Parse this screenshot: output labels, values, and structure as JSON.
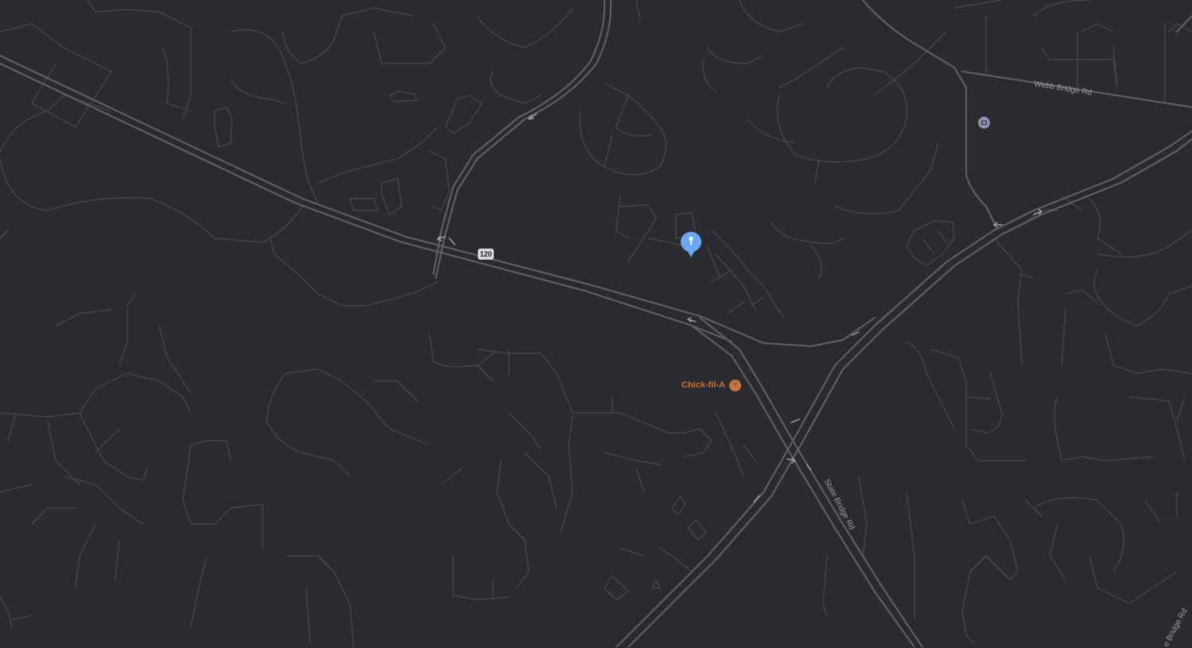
{
  "map": {
    "theme": "dark",
    "colors": {
      "background": "#2a2b2e",
      "minor_road": "#45474b",
      "major_road": "#5b5d62",
      "poi_food": "#c8733f",
      "pin": "#6ba9f2"
    },
    "road_labels": {
      "webb_bridge": "Webb Bridge Rd",
      "state_bridge": "State Bridge Rd",
      "state_bridge_edge": "e Bridge Rd"
    },
    "route_shield": "120",
    "pois": {
      "restaurant": {
        "name": "Chick-fil-A",
        "icon": "restaurant-icon"
      },
      "post_office": {
        "icon": "mail-icon"
      }
    },
    "marker": {
      "icon": "location-pin-icon"
    }
  }
}
